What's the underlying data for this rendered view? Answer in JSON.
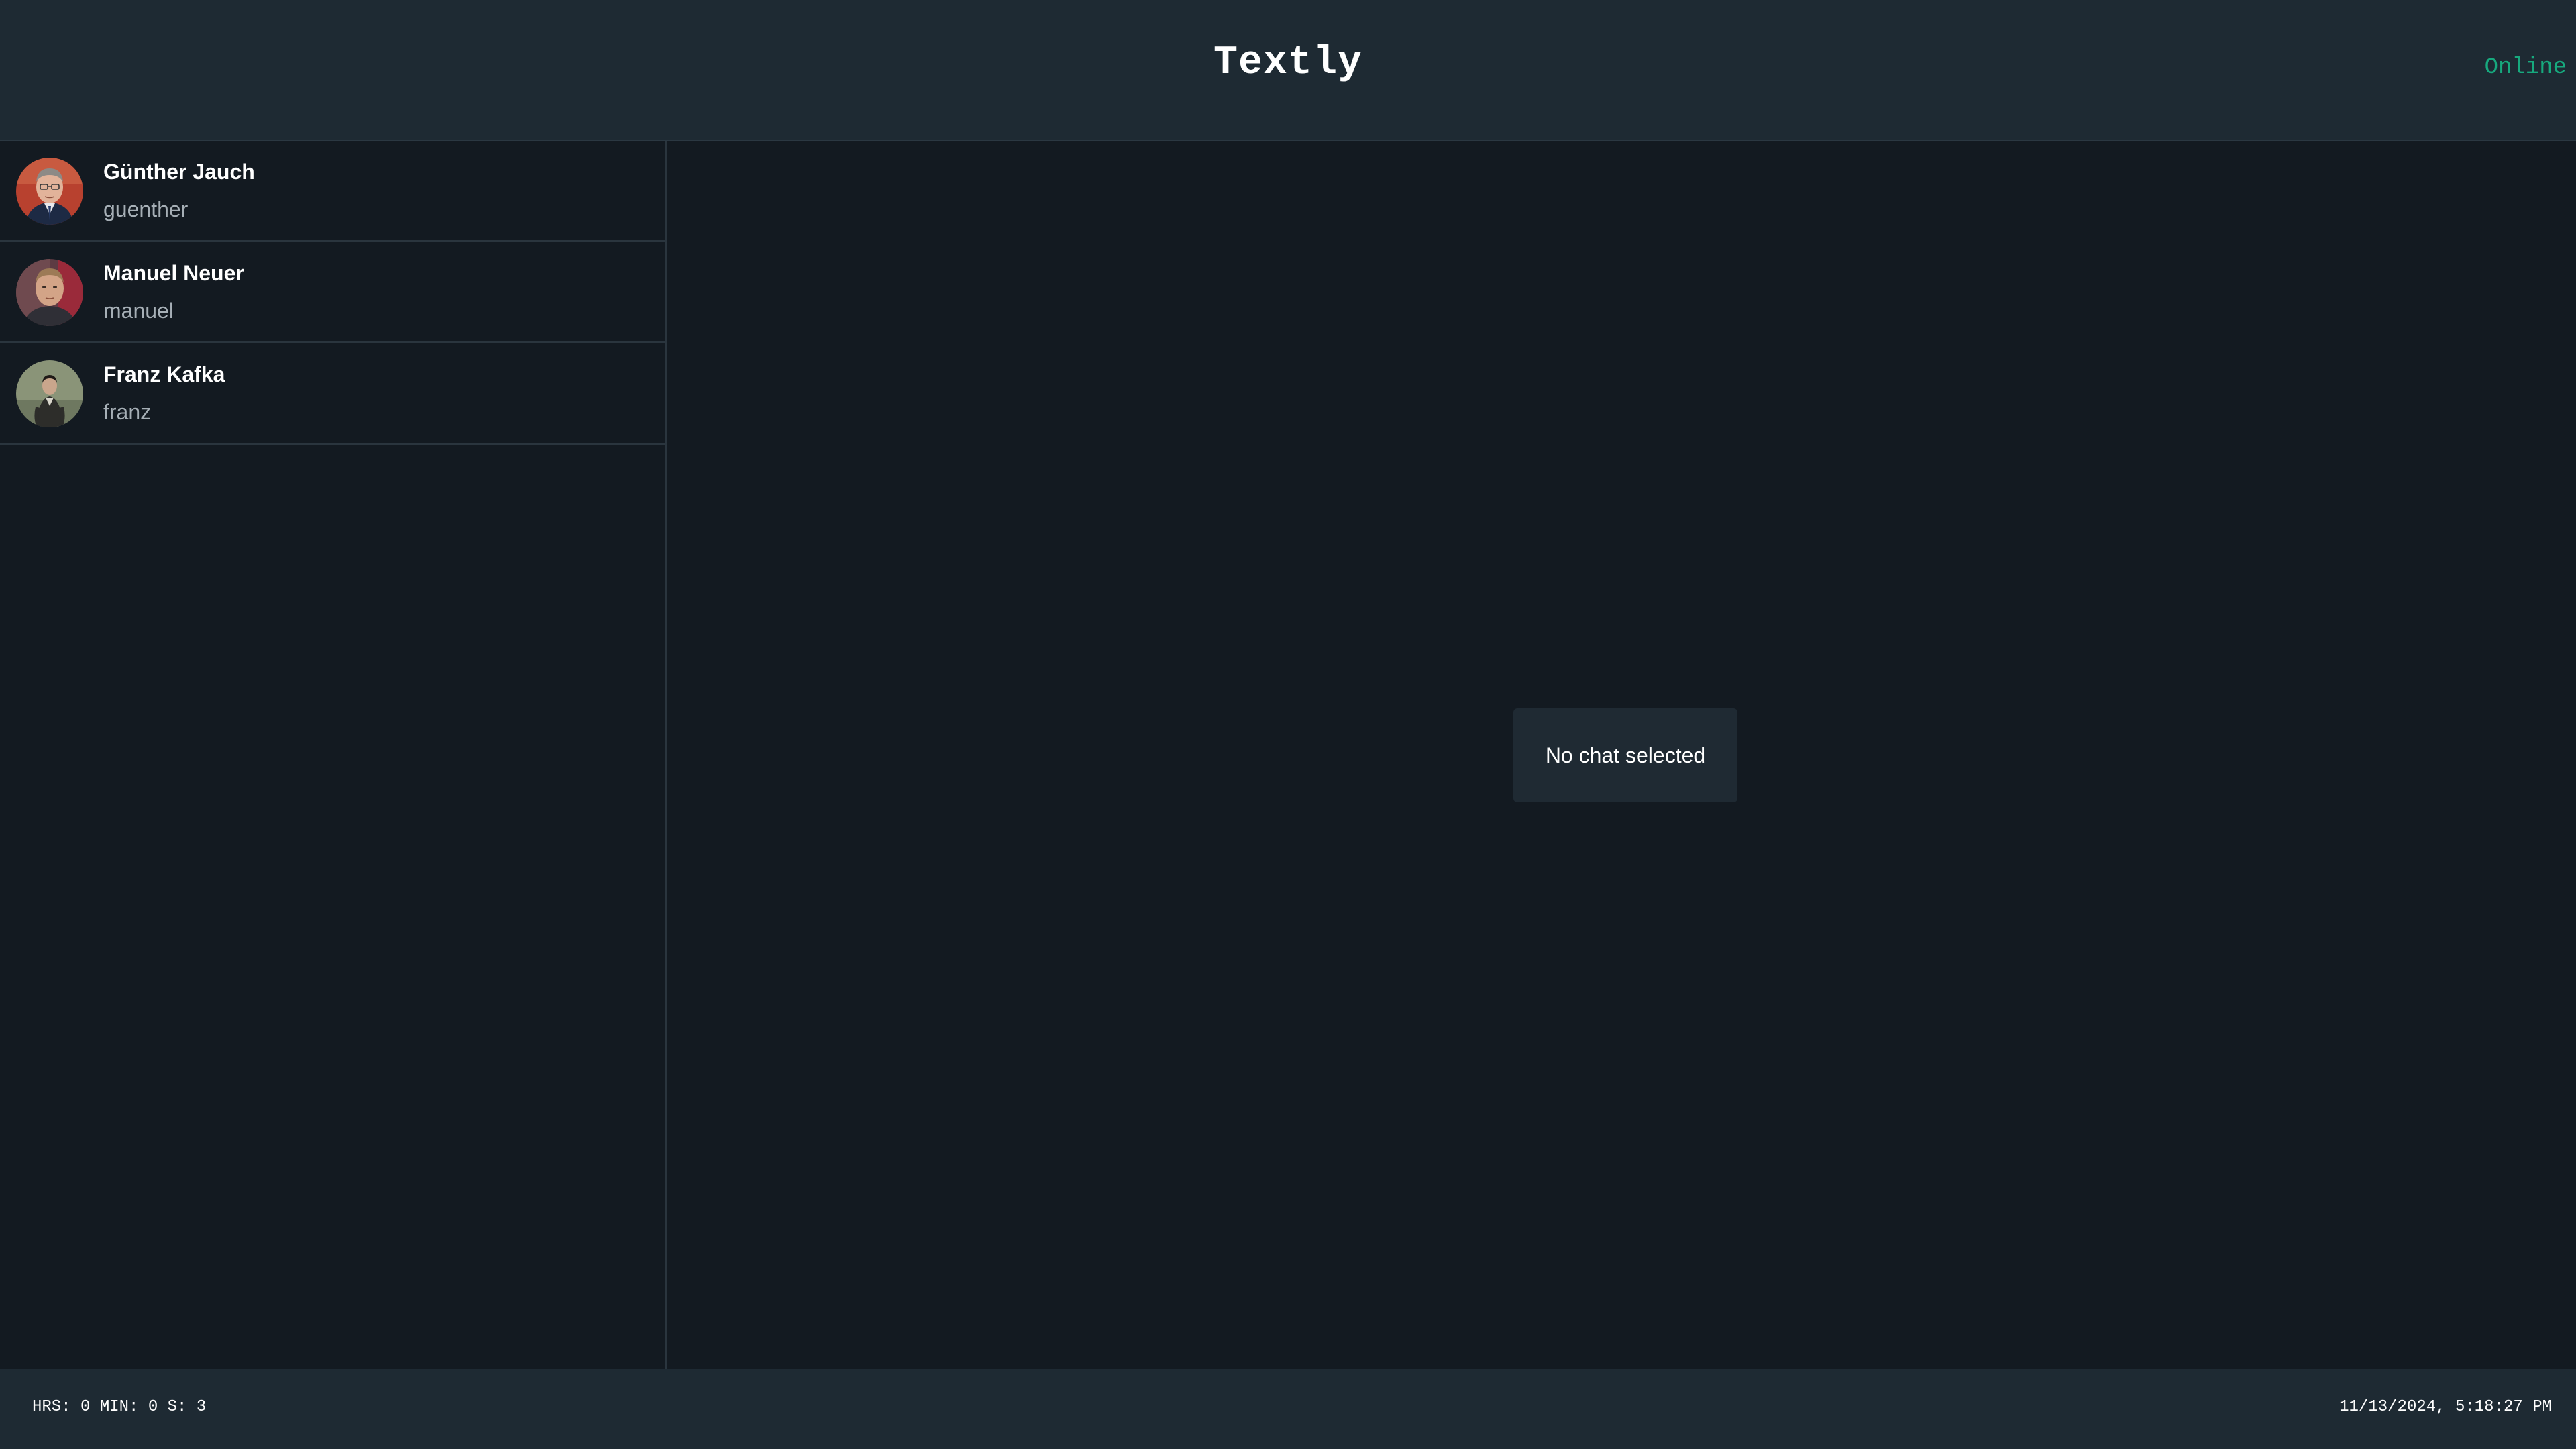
{
  "header": {
    "title": "Textly",
    "status": "Online",
    "status_color": "#17a97e"
  },
  "contacts": [
    {
      "name": "Günther Jauch",
      "username": "guenther",
      "avatar": "person-photo-icon"
    },
    {
      "name": "Manuel Neuer",
      "username": "manuel",
      "avatar": "person-photo-icon"
    },
    {
      "name": "Franz Kafka",
      "username": "franz",
      "avatar": "person-photo-icon"
    }
  ],
  "main": {
    "empty_message": "No chat selected"
  },
  "footer": {
    "session_timer": "HRS: 0 MIN: 0 S: 3",
    "datetime": "11/13/2024, 5:18:27 PM"
  }
}
